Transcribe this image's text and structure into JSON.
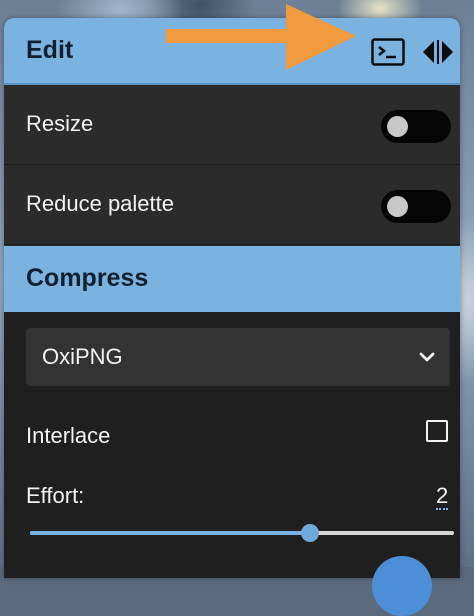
{
  "edit": {
    "title": "Edit",
    "icons": [
      "terminal-icon",
      "code-compare-icon"
    ]
  },
  "options": [
    {
      "label": "Resize",
      "enabled": false
    },
    {
      "label": "Reduce palette",
      "enabled": false
    }
  ],
  "compress": {
    "title": "Compress",
    "method": "OxiPNG",
    "interlace_label": "Interlace",
    "interlace_checked": false,
    "effort_label": "Effort:",
    "effort_value": "2",
    "effort_fraction": 0.66
  },
  "colors": {
    "accent": "#7ab3e0",
    "panel": "#2b2b2b",
    "annotation_arrow": "#f19a3e"
  }
}
